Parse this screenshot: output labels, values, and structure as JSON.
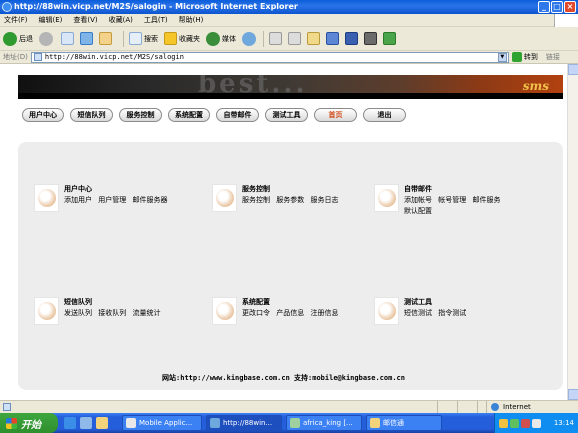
{
  "window": {
    "title": "http://88win.vicp.net/M2S/salogin - Microsoft Internet Explorer",
    "controls": [
      "_",
      "□",
      "×"
    ]
  },
  "menu": [
    "文件(F)",
    "编辑(E)",
    "查看(V)",
    "收藏(A)",
    "工具(T)",
    "帮助(H)"
  ],
  "toolbar": {
    "back_label": "后退",
    "search_label": "搜索",
    "favorites_label": "收藏夹",
    "media_label": "媒体"
  },
  "address": {
    "label": "地址(D)",
    "url": "http://88win.vicp.net/M2S/salogin",
    "go_label": "转到",
    "links_label": "链接"
  },
  "banner": {
    "brand_text": "best...",
    "sms_text": "sms"
  },
  "nav": [
    {
      "label": "用户中心",
      "active": false
    },
    {
      "label": "短信队列",
      "active": false
    },
    {
      "label": "服务控制",
      "active": false
    },
    {
      "label": "系统配置",
      "active": false
    },
    {
      "label": "自带邮件",
      "active": false
    },
    {
      "label": "测试工具",
      "active": false
    },
    {
      "label": "首页",
      "active": true
    },
    {
      "label": "退出",
      "active": false
    }
  ],
  "cards": [
    {
      "title": "用户中心",
      "links": [
        "添加用户",
        "用户管理",
        "邮件服务器"
      ]
    },
    {
      "title": "服务控制",
      "links": [
        "服务控制",
        "服务参数",
        "服务日志"
      ]
    },
    {
      "title": "自带邮件",
      "links": [
        "添加帐号",
        "帐号管理",
        "邮件服务",
        "默认配置"
      ]
    },
    {
      "title": "短信队列",
      "links": [
        "发送队列",
        "接收队列",
        "流量统计"
      ]
    },
    {
      "title": "系统配置",
      "links": [
        "更改口令",
        "产品信息",
        "注册信息"
      ]
    },
    {
      "title": "测试工具",
      "links": [
        "短信测试",
        "指令测试"
      ]
    }
  ],
  "footer": "网站:http://www.kingbase.com.cn 支持:mobile@kingbase.com.cn",
  "status": {
    "zone": "Internet"
  },
  "taskbar": {
    "start_label": "开始",
    "tasks": [
      {
        "label": "Mobile Applic...",
        "active": false
      },
      {
        "label": "http://88win...",
        "active": true
      },
      {
        "label": "africa_king [...",
        "active": false
      },
      {
        "label": "邮信通",
        "active": false
      }
    ],
    "clock": "13:14"
  }
}
